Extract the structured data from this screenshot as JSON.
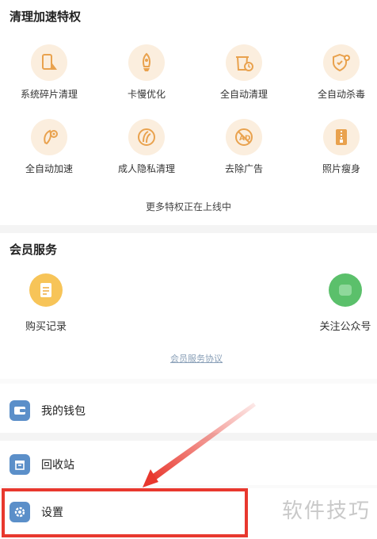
{
  "speedup_section": {
    "title": "清理加速特权",
    "items": [
      {
        "label": "系统碎片清理",
        "icon": "phone-broom-icon"
      },
      {
        "label": "卡慢优化",
        "icon": "rocket-icon"
      },
      {
        "label": "全自动清理",
        "icon": "trash-clock-icon"
      },
      {
        "label": "全自动杀毒",
        "icon": "shield-plus-icon"
      },
      {
        "label": "全自动加速",
        "icon": "rocket-gear-icon"
      },
      {
        "label": "成人隐私清理",
        "icon": "privacy-icon"
      },
      {
        "label": "去除广告",
        "icon": "no-ads-icon"
      },
      {
        "label": "照片瘦身",
        "icon": "photo-zip-icon"
      }
    ],
    "more_text": "更多特权正在上线中"
  },
  "member_section": {
    "title": "会员服务",
    "purchase_label": "购买记录",
    "follow_label": "关注公众号",
    "agreement_link": "会员服务协议"
  },
  "list": {
    "wallet_label": "我的钱包",
    "recycle_label": "回收站",
    "settings_label": "设置"
  },
  "watermark": "软件技巧",
  "colors": {
    "accent_orange": "#f0b060",
    "icon_bg": "#fbeede",
    "list_icon_blue": "#5b8fc9",
    "highlight_red": "#e8382e",
    "wechat_green": "#5bc06b"
  }
}
